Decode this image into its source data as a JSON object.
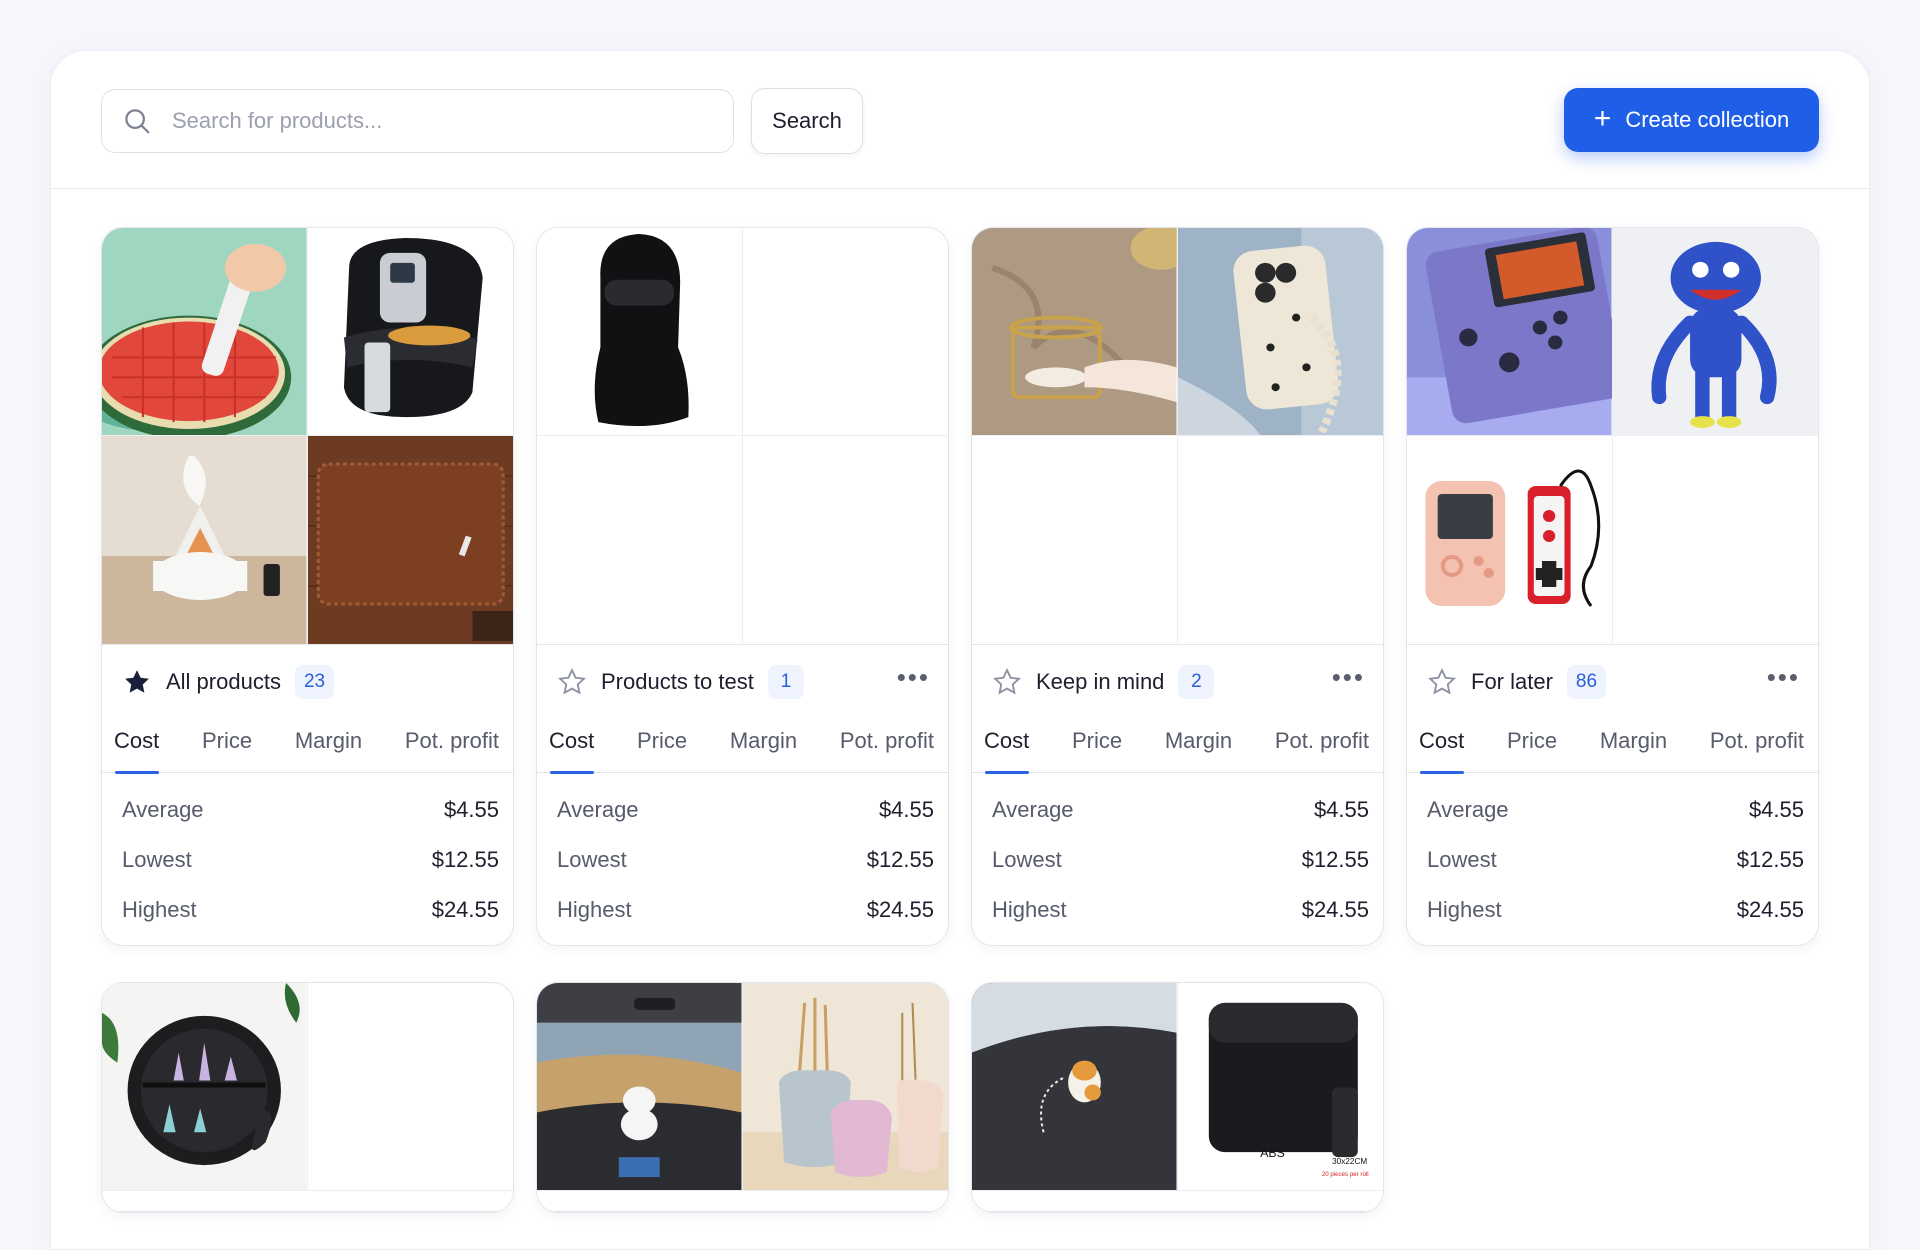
{
  "toolbar": {
    "search_placeholder": "Search for products...",
    "search_label": "Search",
    "create_label": "Create collection",
    "accent": "#1f5fe8"
  },
  "tabs": [
    "Cost",
    "Price",
    "Margin",
    "Pot. profit"
  ],
  "collections": [
    {
      "title": "All products",
      "count": "23",
      "starred": true,
      "has_menu": false,
      "stats": [
        {
          "label": "Average",
          "value": "$4.55"
        },
        {
          "label": "Lowest",
          "value": "$12.55"
        },
        {
          "label": "Highest",
          "value": "$24.55"
        }
      ],
      "images": [
        "watermelon-cutter",
        "air-fryer",
        "humidifier",
        "wallet"
      ]
    },
    {
      "title": "Products to test",
      "count": "1",
      "starred": false,
      "has_menu": true,
      "stats": [
        {
          "label": "Average",
          "value": "$4.55"
        },
        {
          "label": "Lowest",
          "value": "$12.55"
        },
        {
          "label": "Highest",
          "value": "$24.55"
        }
      ],
      "images": [
        "balaclava",
        "",
        "",
        ""
      ]
    },
    {
      "title": "Keep in mind",
      "count": "2",
      "starred": false,
      "has_menu": true,
      "stats": [
        {
          "label": "Average",
          "value": "$4.55"
        },
        {
          "label": "Lowest",
          "value": "$12.55"
        },
        {
          "label": "Highest",
          "value": "$24.55"
        }
      ],
      "images": [
        "soap-holder",
        "phone-case",
        "",
        ""
      ]
    },
    {
      "title": "For later",
      "count": "86",
      "starred": false,
      "has_menu": true,
      "stats": [
        {
          "label": "Average",
          "value": "$4.55"
        },
        {
          "label": "Lowest",
          "value": "$12.55"
        },
        {
          "label": "Highest",
          "value": "$24.55"
        }
      ],
      "images": [
        "handheld-console",
        "blue-plush-toy",
        "retro-game-controllers",
        ""
      ]
    },
    {
      "images": [
        "crystal-shelf",
        ""
      ]
    },
    {
      "images": [
        "car-dashboard-figure",
        "ceramic-vases"
      ]
    },
    {
      "images": [
        "dashboard-cat-figure",
        "car-trash-bin"
      ],
      "trash_bin_text": [
        "ABS",
        "30x22CM",
        "20 pieces per roll"
      ]
    }
  ]
}
